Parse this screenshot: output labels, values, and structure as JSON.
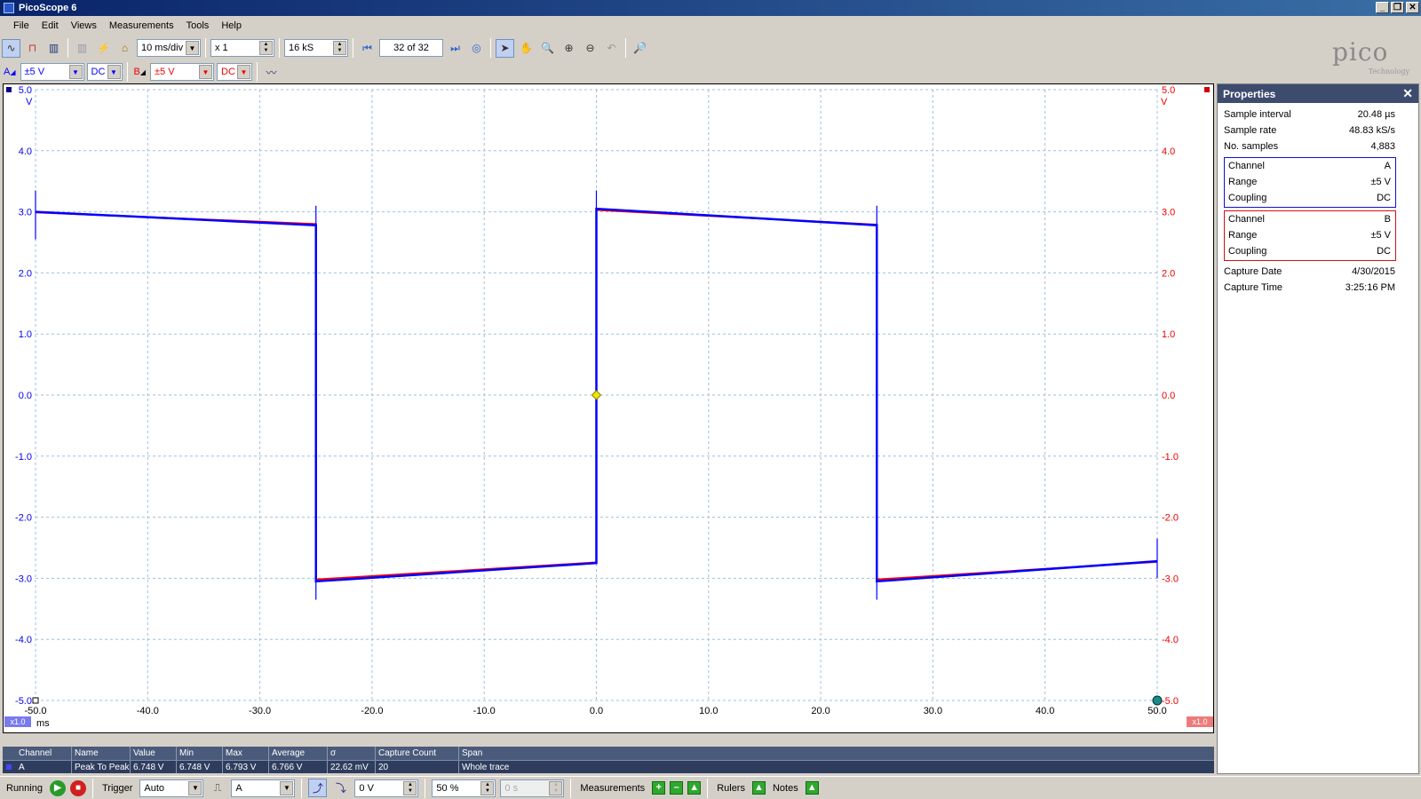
{
  "window": {
    "title": "PicoScope 6"
  },
  "menu": [
    "File",
    "Edit",
    "Views",
    "Measurements",
    "Tools",
    "Help"
  ],
  "toolbar": {
    "timebase": "10 ms/div",
    "zoom": "x 1",
    "samples": "16 kS",
    "buffer": "32 of 32"
  },
  "channels": {
    "a": {
      "label": "A",
      "range": "±5 V",
      "coupling": "DC",
      "color": "#0000ff"
    },
    "b": {
      "label": "B",
      "range": "±5 V",
      "coupling": "DC",
      "color": "#ff0000"
    }
  },
  "logo": {
    "word": "pico",
    "sub": "Technology"
  },
  "scope": {
    "left_unit": "V",
    "right_unit": "V",
    "x_unit": "ms",
    "left_scale_badge": "x1.0",
    "right_scale_badge": "x1.0",
    "y_ticks_left": [
      "5.0",
      "4.0",
      "3.0",
      "2.0",
      "1.0",
      "0.0",
      "-1.0",
      "-2.0",
      "-3.0",
      "-4.0",
      "-5.0"
    ],
    "y_ticks_right": [
      "5.0",
      "4.0",
      "3.0",
      "2.0",
      "1.0",
      "0.0",
      "-1.0",
      "-2.0",
      "-3.0",
      "-4.0",
      "-5.0"
    ],
    "x_ticks": [
      "-50.0",
      "-40.0",
      "-30.0",
      "-20.0",
      "-10.0",
      "0.0",
      "10.0",
      "20.0",
      "30.0",
      "40.0",
      "50.0"
    ]
  },
  "chart_data": {
    "type": "line",
    "xlabel": "ms",
    "ylabel": "V",
    "xlim": [
      -50,
      50
    ],
    "ylim": [
      -5,
      5
    ],
    "grid": true,
    "series": [
      {
        "name": "A",
        "color": "#0000ff",
        "points": [
          [
            -50,
            3.0
          ],
          [
            -25,
            2.78
          ],
          [
            -25,
            -3.05
          ],
          [
            0,
            -2.75
          ],
          [
            0,
            3.05
          ],
          [
            25,
            2.78
          ],
          [
            25,
            -3.05
          ],
          [
            50,
            -2.72
          ]
        ]
      },
      {
        "name": "B",
        "color": "#ff0000",
        "points": [
          [
            -50,
            2.99
          ],
          [
            -25,
            2.8
          ],
          [
            -25,
            -3.02
          ],
          [
            0,
            -2.74
          ],
          [
            0,
            3.03
          ],
          [
            25,
            2.79
          ],
          [
            25,
            -3.02
          ],
          [
            50,
            -2.73
          ]
        ]
      }
    ],
    "trigger": {
      "x": 0,
      "y": 0
    }
  },
  "measurements": {
    "headers": [
      "Channel",
      "Name",
      "Value",
      "Min",
      "Max",
      "Average",
      "σ",
      "Capture Count",
      "Span"
    ],
    "rows": [
      {
        "channel": "A",
        "name": "Peak To Peak",
        "value": "6.748 V",
        "min": "6.748 V",
        "max": "6.793 V",
        "average": "6.766 V",
        "sigma": "22.62 mV",
        "count": "20",
        "span": "Whole trace"
      }
    ]
  },
  "status": {
    "running": "Running",
    "trigger_label": "Trigger",
    "trigger_mode": "Auto",
    "trigger_source": "A",
    "threshold": "0 V",
    "pretrigger": "50 %",
    "delay": "0 s",
    "measurements_label": "Measurements",
    "rulers_label": "Rulers",
    "notes_label": "Notes"
  },
  "properties": {
    "title": "Properties",
    "top": [
      {
        "label": "Sample interval",
        "value": "20.48 µs"
      },
      {
        "label": "Sample rate",
        "value": "48.83 kS/s"
      },
      {
        "label": "No. samples",
        "value": "4,883"
      }
    ],
    "channel_a": [
      {
        "label": "Channel",
        "value": "A"
      },
      {
        "label": "Range",
        "value": "±5 V"
      },
      {
        "label": "Coupling",
        "value": "DC"
      }
    ],
    "channel_b": [
      {
        "label": "Channel",
        "value": "B"
      },
      {
        "label": "Range",
        "value": "±5 V"
      },
      {
        "label": "Coupling",
        "value": "DC"
      }
    ],
    "capture": [
      {
        "label": "Capture Date",
        "value": "4/30/2015"
      },
      {
        "label": "Capture Time",
        "value": "3:25:16 PM"
      }
    ]
  }
}
